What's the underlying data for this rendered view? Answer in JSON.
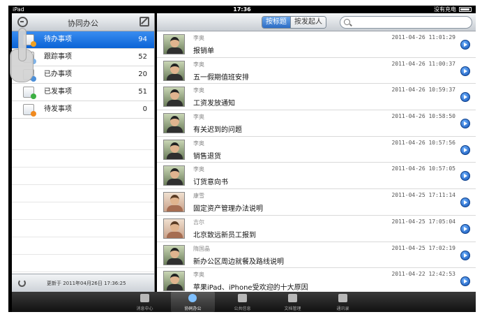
{
  "status_bar": {
    "device": "iPad",
    "time": "17:36",
    "battery_text": "没有充电"
  },
  "sidebar": {
    "title": "协同办公",
    "items": [
      {
        "label": "待办事项",
        "count": "94",
        "icon": "pending-doc-icon",
        "active": true
      },
      {
        "label": "跟踪事项",
        "count": "52",
        "icon": "track-doc-icon",
        "active": false
      },
      {
        "label": "已办事项",
        "count": "20",
        "icon": "done-doc-icon",
        "active": false
      },
      {
        "label": "已发事项",
        "count": "51",
        "icon": "sent-doc-icon",
        "active": false
      },
      {
        "label": "待发事项",
        "count": "0",
        "icon": "tosend-doc-icon",
        "active": false
      }
    ],
    "footer": {
      "updated": "更新于 2011年04月26日 17:36:25"
    }
  },
  "main": {
    "segments": [
      {
        "label": "按标题",
        "active": true
      },
      {
        "label": "按发起人",
        "active": false
      }
    ],
    "search": {
      "placeholder": ""
    },
    "messages": [
      {
        "sender": "李奥",
        "subject": "报销单",
        "time": "2011-04-26 11:01:29",
        "avatar": "male"
      },
      {
        "sender": "李奥",
        "subject": "五一假期值班安排",
        "time": "2011-04-26 11:00:37",
        "avatar": "male"
      },
      {
        "sender": "李奥",
        "subject": "工资发放通知",
        "time": "2011-04-26 10:59:37",
        "avatar": "male"
      },
      {
        "sender": "李奥",
        "subject": "有关迟到的问题",
        "time": "2011-04-26 10:58:50",
        "avatar": "male"
      },
      {
        "sender": "李奥",
        "subject": "销售退货",
        "time": "2011-04-26 10:57:56",
        "avatar": "male"
      },
      {
        "sender": "李奥",
        "subject": "订货意向书",
        "time": "2011-04-26 10:57:05",
        "avatar": "male"
      },
      {
        "sender": "康雪",
        "subject": "固定资产管理办法说明",
        "time": "2011-04-25 17:11:14",
        "avatar": "female"
      },
      {
        "sender": "吉尔",
        "subject": "北京致远新员工报到",
        "time": "2011-04-25 17:05:04",
        "avatar": "female"
      },
      {
        "sender": "隋国晶",
        "subject": "新办公区周边就餐及路线说明",
        "time": "2011-04-25 17:02:19",
        "avatar": "male"
      },
      {
        "sender": "李奥",
        "subject": "苹果iPad、iPhone受欢迎的十大原因",
        "time": "2011-04-22 12:42:53",
        "avatar": "male"
      }
    ]
  },
  "tabbar": {
    "tabs": [
      {
        "label": "消息中心",
        "icon": "message-center-icon",
        "active": false
      },
      {
        "label": "协同办公",
        "icon": "collaboration-icon",
        "active": true
      },
      {
        "label": "公共信息",
        "icon": "public-info-icon",
        "active": false
      },
      {
        "label": "文档管理",
        "icon": "document-icon",
        "active": false
      },
      {
        "label": "通讯录",
        "icon": "contacts-icon",
        "active": false
      }
    ]
  },
  "colors": {
    "active_blue": "#0a63d6",
    "segment_blue": "#2c6cc4",
    "tab_active_icon": "#7fc0ff"
  }
}
